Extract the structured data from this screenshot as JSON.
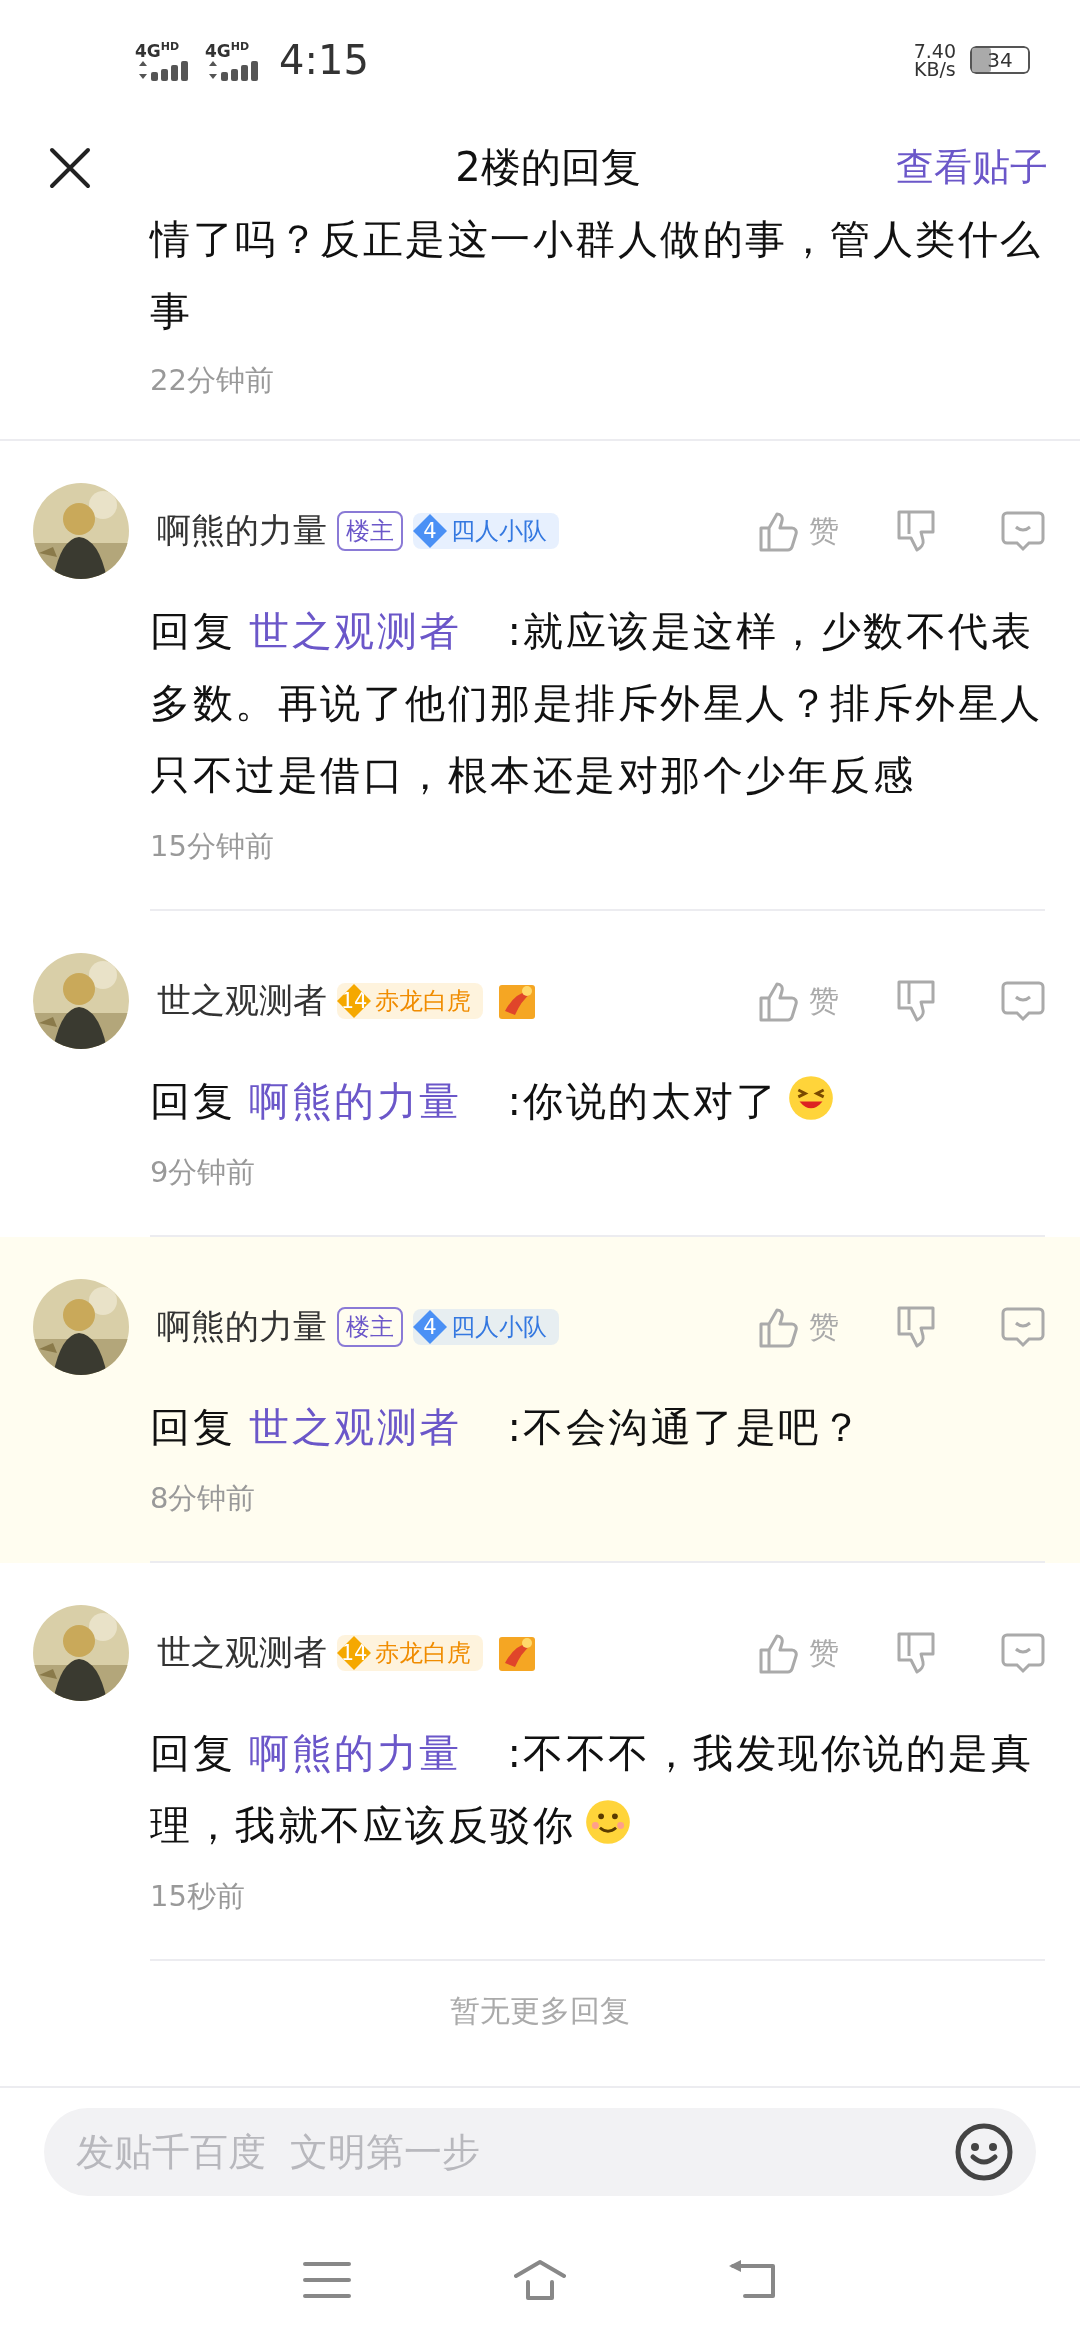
{
  "status_bar": {
    "signals": [
      "4G$^{HD}$",
      "4G$^{HD}$"
    ],
    "time": "4:15",
    "speed": "7.40",
    "speed_unit": "KB/s",
    "battery": "34"
  },
  "header": {
    "title": "2楼的回复",
    "link": "查看贴子"
  },
  "previous": {
    "text": "情了吗？反正是这一小群人做的事，管人类什么事",
    "time": "22分钟前"
  },
  "comments": [
    {
      "name": "啊熊的力量",
      "op_badge": "楼主",
      "level_badge": {
        "number": "4",
        "title": "四人小队",
        "color": "#4a90f5"
      },
      "medal": false,
      "like": "赞",
      "reply_prefix": "回复",
      "reply_to": "世之观测者",
      "text": ":就应该是这样，少数不代表多数。再说了他们那是排斥外星人？排斥外星人只不过是借口，根本还是对那个少年反感",
      "time": "15分钟前",
      "highlighted": false
    },
    {
      "name": "世之观测者",
      "level_badge": {
        "number": "14",
        "title": "赤龙白虎",
        "color": "#f5a800"
      },
      "medal": true,
      "like": "赞",
      "reply_prefix": "回复",
      "reply_to": "啊熊的力量",
      "text": ":你说的太对了",
      "emoji": {
        "kind": "laugh"
      },
      "time": "9分钟前",
      "highlighted": false
    },
    {
      "name": "啊熊的力量",
      "op_badge": "楼主",
      "level_badge": {
        "number": "4",
        "title": "四人小队",
        "color": "#4a90f5"
      },
      "medal": false,
      "like": "赞",
      "reply_prefix": "回复",
      "reply_to": "世之观测者",
      "text": ":不会沟通了是吧？",
      "time": "8分钟前",
      "highlighted": true
    },
    {
      "name": "世之观测者",
      "level_badge": {
        "number": "14",
        "title": "赤龙白虎",
        "color": "#f5a800"
      },
      "medal": true,
      "like": "赞",
      "reply_prefix": "回复",
      "reply_to": "啊熊的力量",
      "text": ":不不不，我发现你说的是真理，我就不应该反驳你",
      "emoji": {
        "kind": "smile"
      },
      "time": "15秒前",
      "highlighted": false
    }
  ],
  "end_note": "暂无更多回复",
  "input": {
    "placeholder": "发贴千百度  文明第一步"
  }
}
